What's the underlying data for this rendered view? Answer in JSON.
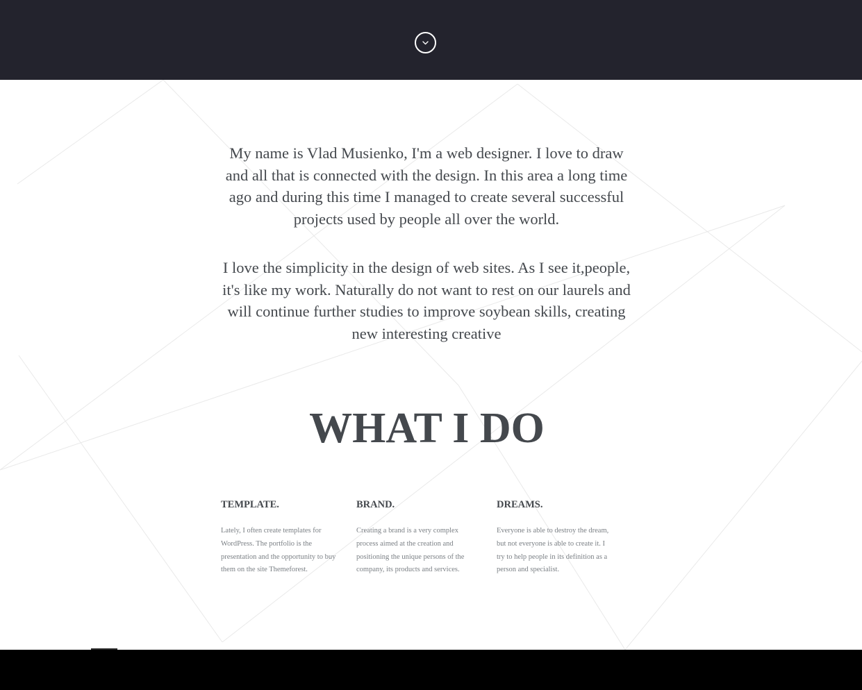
{
  "header": {
    "scroll_icon": "chevron-down-icon",
    "background": "#23232d"
  },
  "about": {
    "paragraph_1": "My name is Vlad Musienko, I'm a web designer. I love to draw and all that is connected with the design. In this area a long time ago and during this time I managed to create several successful projects used by people all over the world.",
    "paragraph_2": "I love the simplicity in the design of web sites. As I see it,people, it's like my work. Naturally do not want to rest on our laurels and will continue further studies to improve soybean skills, creating new interesting creative"
  },
  "what_i_do": {
    "title": "WHAT I DO",
    "services": [
      {
        "title": "TEMPLATE.",
        "text": "Lately, I often create templates for WordPress. The portfolio is the presentation and the opportunity to buy them on the site Themeforest."
      },
      {
        "title": "BRAND.",
        "text": "Creating a brand is a very complex process aimed at the creation and positioning the unique persons of the company, its products and services."
      },
      {
        "title": "DREAMS.",
        "text": "Everyone is able to destroy the dream, but not everyone is able to create it. I try to help people in its definition as a person and specialist."
      }
    ]
  },
  "colors": {
    "text": "#44484d",
    "muted_text": "#7a7f84",
    "page_bg": "#ffffff",
    "footer_bg": "#000000"
  }
}
